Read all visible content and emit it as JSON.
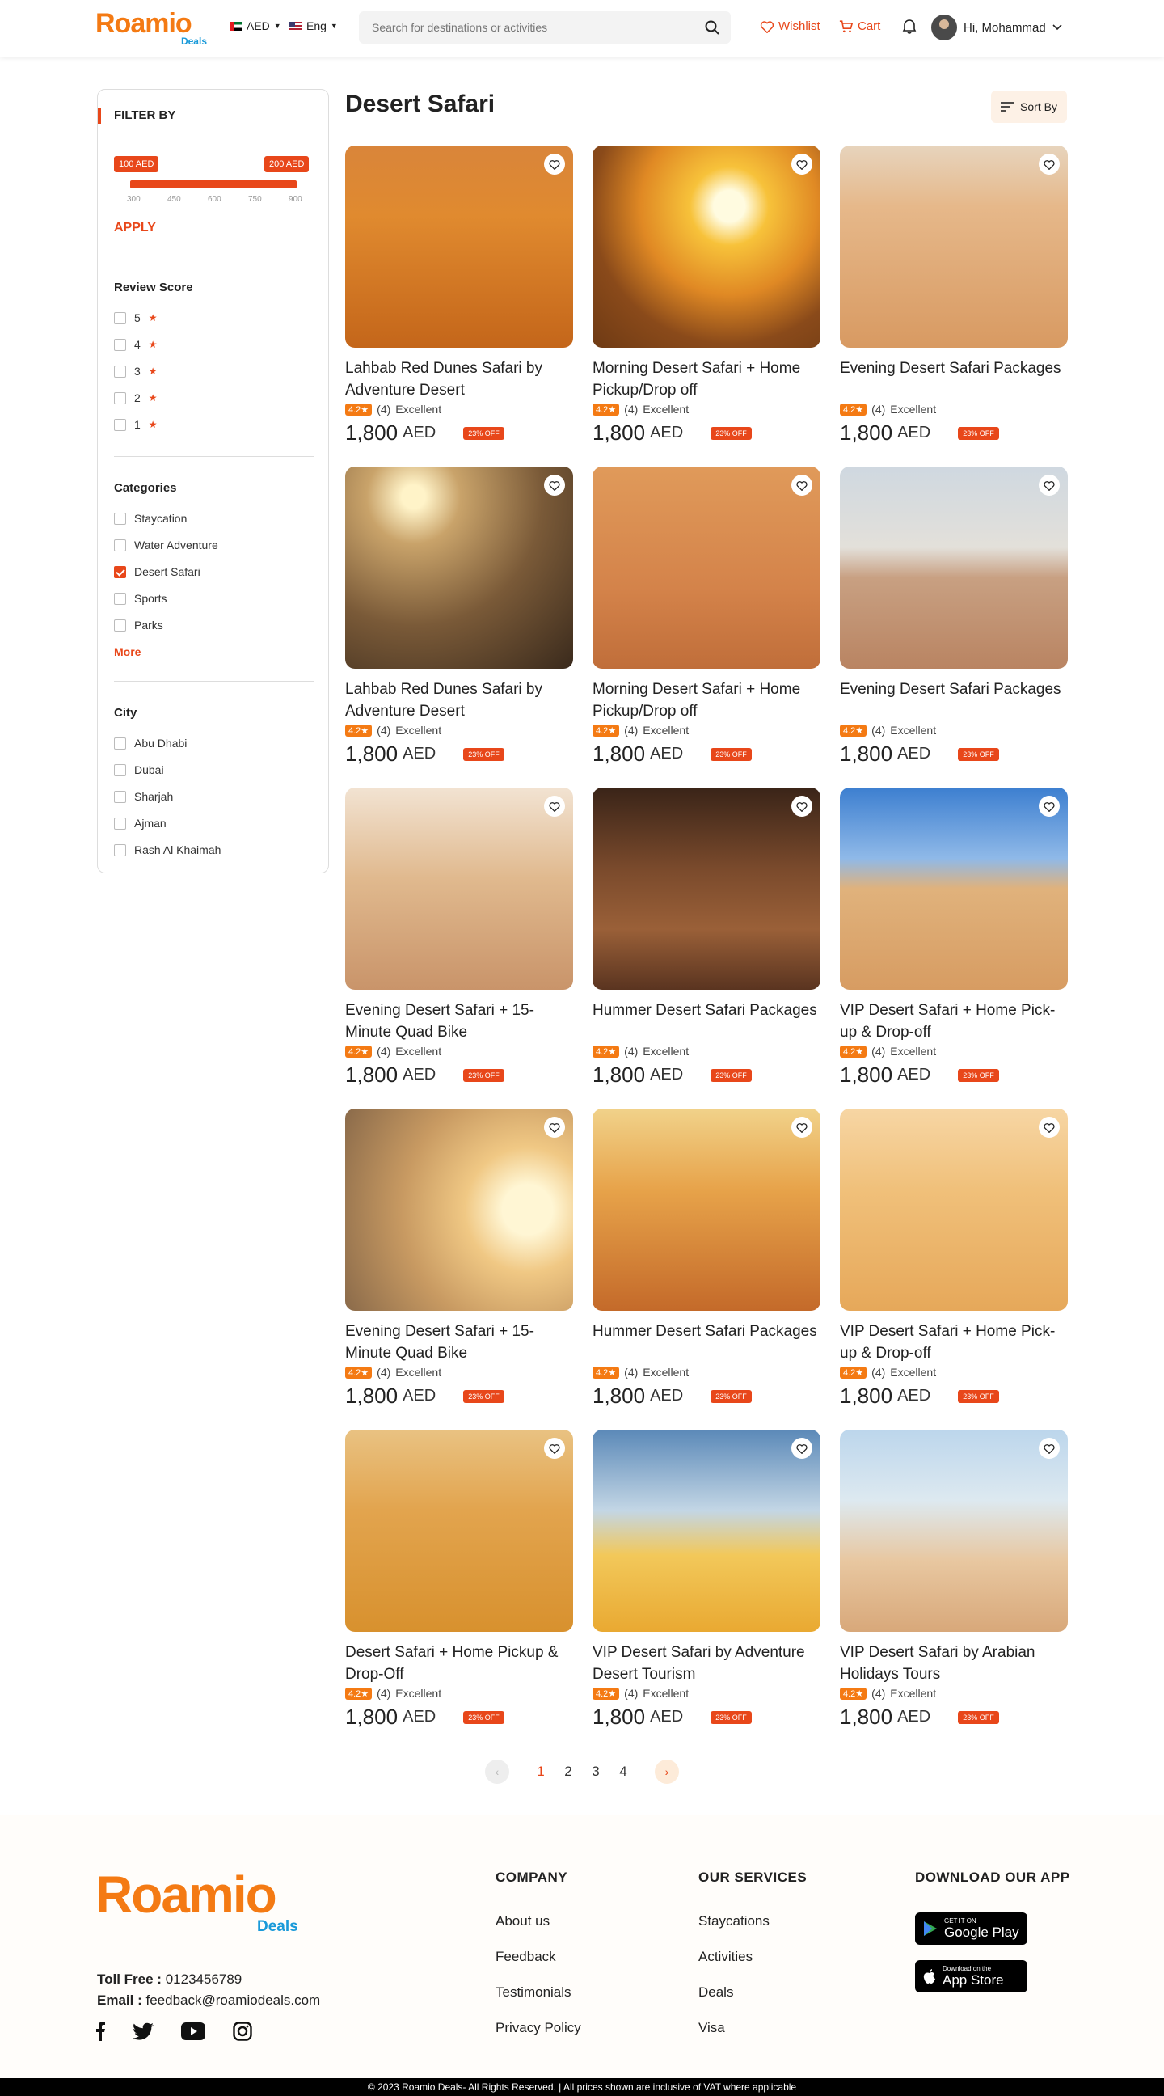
{
  "header": {
    "logo_main": "Roamio",
    "logo_sub": "Deals",
    "currency": "AED",
    "language": "Eng",
    "search_placeholder": "Search for destinations or activities",
    "wishlist": "Wishlist",
    "cart": "Cart",
    "greeting": "Hi, Mohammad"
  },
  "filters": {
    "heading": "FILTER BY",
    "range_min_tag": "100 AED",
    "range_max_tag": "200 AED",
    "range_ticks": [
      "300",
      "450",
      "600",
      "750",
      "900"
    ],
    "apply": "APPLY",
    "review_title": "Review Score",
    "review_scores": [
      "5",
      "4",
      "3",
      "2",
      "1"
    ],
    "categories_title": "Categories",
    "categories": [
      {
        "label": "Staycation",
        "checked": false
      },
      {
        "label": "Water Adventure",
        "checked": false
      },
      {
        "label": "Desert Safari",
        "checked": true
      },
      {
        "label": "Sports",
        "checked": false
      },
      {
        "label": "Parks",
        "checked": false
      }
    ],
    "more": "More",
    "city_title": "City",
    "cities": [
      "Abu Dhabi",
      "Dubai",
      "Sharjah",
      "Ajman",
      "Rash Al Khaimah"
    ]
  },
  "main": {
    "title": "Desert Safari",
    "sort_label": "Sort By"
  },
  "card_common": {
    "rating": "4.2",
    "reviews": "(4)",
    "rating_text": "Excellent",
    "price": "1,800",
    "currency": "AED",
    "discount": "23% OFF"
  },
  "cards": [
    {
      "name": "Lahbab Red Dunes Safari by Adventure Desert",
      "scene": "dunes-red-cars"
    },
    {
      "name": "Morning Desert Safari + Home Pickup/Drop off",
      "scene": "sunset-suv"
    },
    {
      "name": "Evening Desert Safari Packages",
      "scene": "dune-bashing"
    },
    {
      "name": "Lahbab Red Dunes Safari by Adventure Desert",
      "scene": "camel-ride"
    },
    {
      "name": "Morning Desert Safari + Home Pickup/Drop off",
      "scene": "white-suv-dune"
    },
    {
      "name": "Evening Desert Safari Packages",
      "scene": "quad-flat"
    },
    {
      "name": "Evening Desert Safari + 15-Minute Quad Bike",
      "scene": "black-jeep"
    },
    {
      "name": "Hummer Desert Safari Packages",
      "scene": "white-suv-dark"
    },
    {
      "name": "VIP Desert Safari + Home Pick-up & Drop-off",
      "scene": "buggy"
    },
    {
      "name": "Evening Desert Safari + 15-Minute Quad Bike",
      "scene": "quad-rider"
    },
    {
      "name": "Hummer Desert Safari Packages",
      "scene": "red-jeep"
    },
    {
      "name": "VIP Desert Safari + Home Pick-up & Drop-off",
      "scene": "white-car-dust"
    },
    {
      "name": "Desert Safari + Home Pickup & Drop-Off",
      "scene": "camel-riders"
    },
    {
      "name": "VIP Desert Safari by Adventure Desert Tourism",
      "scene": "camel-caravan"
    },
    {
      "name": "VIP Desert Safari by Arabian Holidays Tours",
      "scene": "suv-pair"
    }
  ],
  "pagination": {
    "pages": [
      "1",
      "2",
      "3",
      "4"
    ],
    "current": "1",
    "prev_icon": "chevron-left-icon",
    "next_icon": "chevron-right-icon"
  },
  "footer": {
    "logo_main": "Roamio",
    "logo_sub": "Deals",
    "tollfree_label": "Toll Free :",
    "tollfree": "0123456789",
    "email_label": "Email :",
    "email": "feedback@roamiodeals.com",
    "company_title": "COMPANY",
    "company_links": [
      "About us",
      "Feedback",
      "Testimonials",
      "Privacy Policy"
    ],
    "services_title": "OUR SERVICES",
    "services_links": [
      "Staycations",
      "Activities",
      "Deals",
      "Visa"
    ],
    "app_title": "DOWNLOAD OUR APP",
    "google_small": "GET IT ON",
    "google_big": "Google Play",
    "apple_small": "Download on the",
    "apple_big": "App Store",
    "copyright": "© 2023 Roamio Deals- All Rights Reserved. | All prices shown are inclusive of VAT where applicable"
  },
  "colors": {
    "accent": "#e8471a",
    "brand_orange": "#f47a13",
    "brand_blue": "#1a9ad9"
  }
}
